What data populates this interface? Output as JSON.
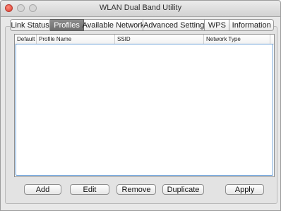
{
  "window": {
    "title": "WLAN Dual Band Utility"
  },
  "tabs": [
    {
      "label": "Link Status",
      "active": false
    },
    {
      "label": "Profiles",
      "active": true
    },
    {
      "label": "Available Network",
      "active": false
    },
    {
      "label": "Advanced Setting",
      "active": false
    },
    {
      "label": "WPS",
      "active": false
    },
    {
      "label": "Information",
      "active": false
    }
  ],
  "profiles_table": {
    "columns": [
      "Default",
      "Profile Name",
      "SSID",
      "Network Type"
    ],
    "rows": []
  },
  "buttons": {
    "add": "Add",
    "edit": "Edit",
    "remove": "Remove",
    "duplicate": "Duplicate",
    "apply": "Apply"
  },
  "colors": {
    "active_tab": "#7a7a7a",
    "focus_ring": "#6a9fd8",
    "close_button": "#dd3b2d"
  }
}
